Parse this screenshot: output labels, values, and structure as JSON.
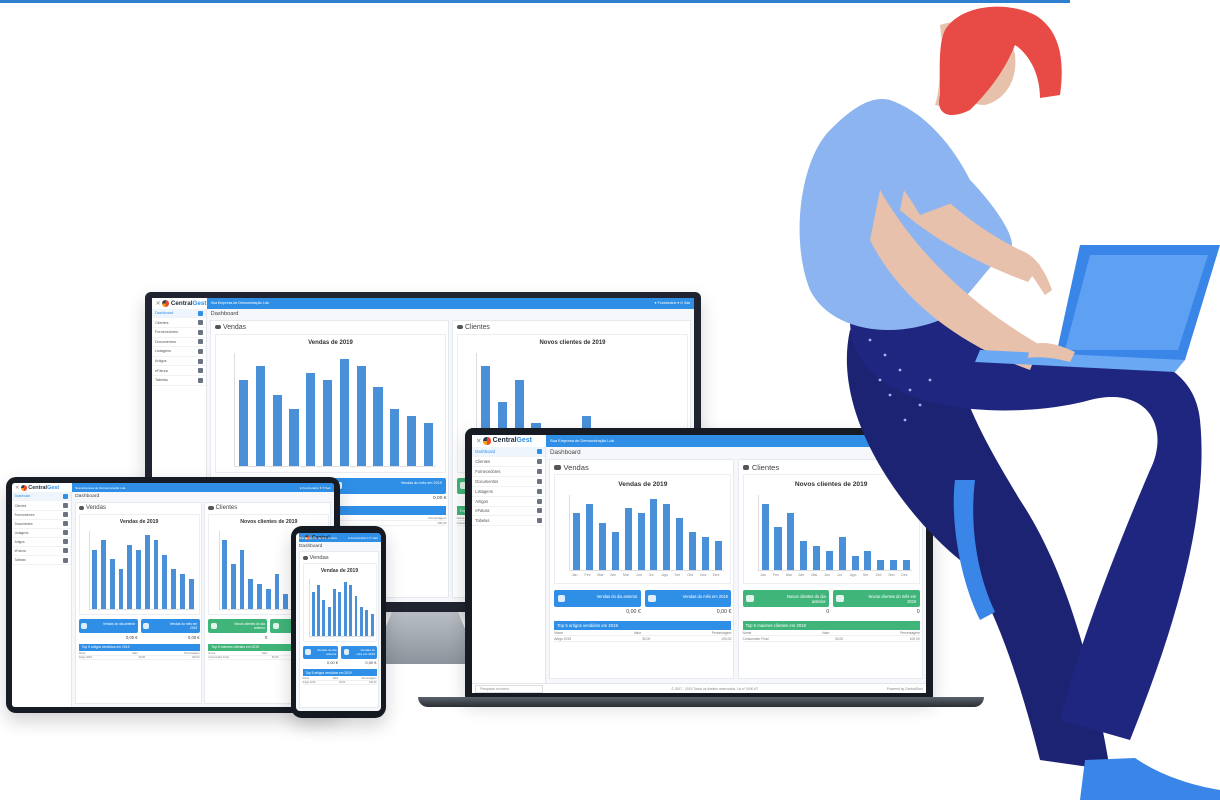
{
  "brand": {
    "logo_prefix": "Central",
    "logo_suffix": "Gest",
    "company": "Sua Empresa de Demonstração Lda",
    "user": "Funcionário",
    "exit": "Sair"
  },
  "menu": [
    "Dashboard",
    "Clientes",
    "Fornecedores",
    "Documentos",
    "Listagens",
    "Artigos",
    "eFatura",
    "Tabelas"
  ],
  "page_title": "Dashboard",
  "panels": {
    "sales": {
      "title": "Vendas",
      "card1_label": "Vendas do dia anterior",
      "card1_value": "0,00 €",
      "card2_label": "Vendas do mês em 2019",
      "card2_value": "0,00 €",
      "table_title": "Top 5 artigos vendidos em 2019",
      "table_cols": [
        "Nome",
        "Valor",
        "Percentagem"
      ],
      "table_row": [
        "Artigo 2019",
        "30,00",
        "100,00"
      ]
    },
    "clients": {
      "title": "Clientes",
      "card1_label": "Novos clientes do dia anterior",
      "card1_value": "0",
      "card2_label": "Novos clientes do mês em 2019",
      "card2_value": "0",
      "table_title": "Top 5 maiores clientes em 2019",
      "table_cols": [
        "Nome",
        "Valor",
        "Percentagem"
      ],
      "table_row": [
        "Consumidor Final",
        "30,00",
        "100,00"
      ]
    }
  },
  "footer": {
    "left": "Pesquisar no menu",
    "center": "© 2007 - 2019 Todos os direitos reservados. Lic.nº 0000 AT",
    "right": "Powered by CentralGest"
  },
  "chart_data": [
    {
      "type": "bar",
      "title": "Vendas de 2019",
      "categories": [
        "Jan",
        "Fev",
        "Mar",
        "Abr",
        "Mai",
        "Jun",
        "Jul",
        "Ago",
        "Set",
        "Out",
        "Nov",
        "Dez"
      ],
      "values": [
        12,
        14,
        10,
        8,
        13,
        12,
        15,
        14,
        11,
        8,
        7,
        6
      ],
      "ylim": [
        0,
        16
      ]
    },
    {
      "type": "bar",
      "title": "Novos clientes de 2019",
      "categories": [
        "Jan",
        "Fev",
        "Mar",
        "Abr",
        "Mai",
        "Jun",
        "Jul",
        "Ago",
        "Set",
        "Out",
        "Nov",
        "Dez"
      ],
      "values": [
        14,
        9,
        12,
        6,
        5,
        4,
        7,
        3,
        4,
        2,
        2,
        2
      ],
      "ylim": [
        0,
        16
      ]
    }
  ]
}
